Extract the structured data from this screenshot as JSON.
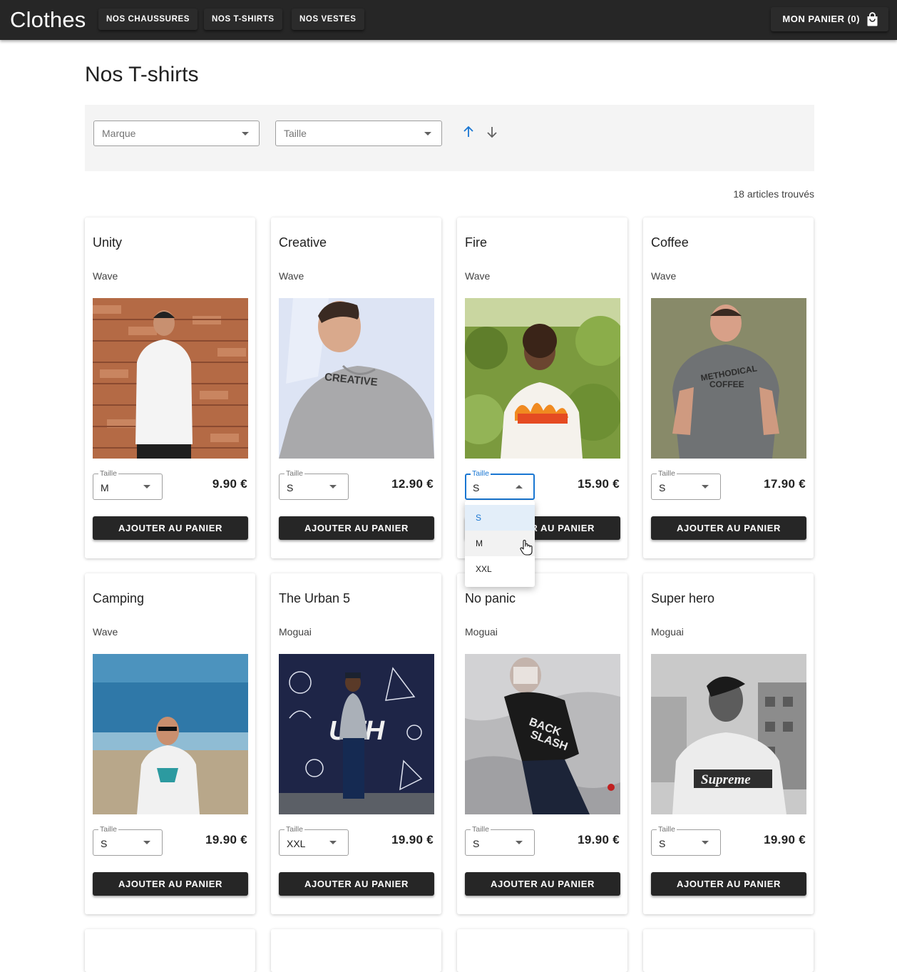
{
  "header": {
    "brand": "Clothes",
    "nav": [
      "NOS CHAUSSURES",
      "NOS T-SHIRTS",
      "NOS VESTES"
    ],
    "cart_label": "MON PANIER (0)"
  },
  "page": {
    "title": "Nos T-shirts",
    "result_count": "18 articles trouvés"
  },
  "filters": {
    "brand_placeholder": "Marque",
    "size_placeholder": "Taille"
  },
  "size_label": "Taille",
  "add_to_cart_label": "AJOUTER AU PANIER",
  "dropdown": {
    "options": [
      "S",
      "M",
      "XXL"
    ],
    "selected": "S",
    "hovered": "M"
  },
  "products": [
    {
      "name": "Unity",
      "brand": "Wave",
      "size": "M",
      "price": "9.90 €",
      "photo": "man in white t-shirt against brick wall"
    },
    {
      "name": "Creative",
      "brand": "Wave",
      "size": "S",
      "price": "12.90 €",
      "photo": "man in grey CREATIVE t-shirt"
    },
    {
      "name": "Fire",
      "brand": "Wave",
      "size": "S",
      "price": "15.90 €",
      "photo": "young man in flame logo t-shirt in nature",
      "dropdown_open": true
    },
    {
      "name": "Coffee",
      "brand": "Wave",
      "size": "S",
      "price": "17.90 €",
      "photo": "man in grey METHODICAL COFFEE t-shirt"
    },
    {
      "name": "Camping",
      "brand": "Wave",
      "size": "S",
      "price": "19.90 €",
      "photo": "man with sunglasses at beach"
    },
    {
      "name": "The Urban 5",
      "brand": "Moguai",
      "size": "XXL",
      "price": "19.90 €",
      "photo": "man in front of YOUTH mural"
    },
    {
      "name": "No panic",
      "brand": "Moguai",
      "size": "S",
      "price": "19.90 €",
      "photo": "man lying on bed in BACK SLASH t-shirt"
    },
    {
      "name": "Super hero",
      "brand": "Moguai",
      "size": "S",
      "price": "19.90 €",
      "photo": "black and white man in Supreme t-shirt"
    }
  ],
  "icons": {
    "cart": "shopping-bag-icon",
    "sort_asc": "arrow-up-icon",
    "sort_desc": "arrow-down-icon"
  },
  "colors": {
    "topbar": "#262626",
    "accent": "#1976d2",
    "button": "#262626",
    "filter_bg": "#f4f4f4"
  }
}
